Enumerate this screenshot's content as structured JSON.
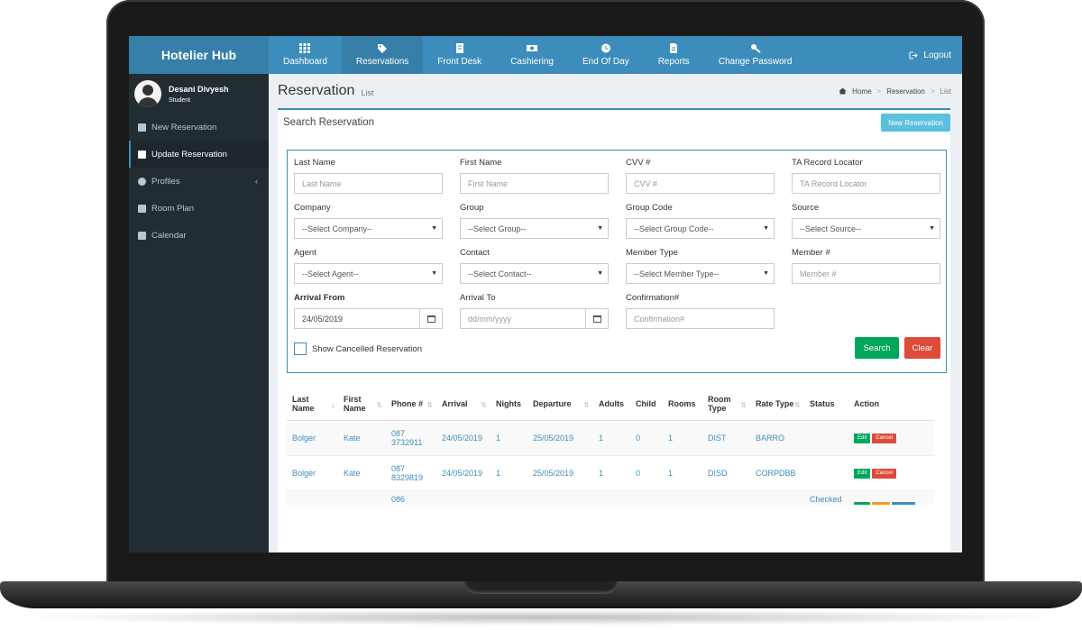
{
  "app": {
    "brand": "Hotelier Hub"
  },
  "nav": {
    "items": [
      {
        "label": "Dashboard",
        "icon": "grid-icon"
      },
      {
        "label": "Reservations",
        "icon": "tag-icon"
      },
      {
        "label": "Front Desk",
        "icon": "book-icon"
      },
      {
        "label": "Cashiering",
        "icon": "money-icon"
      },
      {
        "label": "End Of Day",
        "icon": "clock-icon"
      },
      {
        "label": "Reports",
        "icon": "file-icon"
      },
      {
        "label": "Change Password",
        "icon": "key-icon"
      }
    ],
    "active": "Reservations",
    "logout": "Logout"
  },
  "user": {
    "name": "Desani Divyesh",
    "role": "Student"
  },
  "sidebar": {
    "items": [
      {
        "label": "New Reservation",
        "icon": "tag-icon"
      },
      {
        "label": "Update Reservation",
        "icon": "edit-icon"
      },
      {
        "label": "Profiles",
        "icon": "user-icon"
      },
      {
        "label": "Room Plan",
        "icon": "bed-icon"
      },
      {
        "label": "Calendar",
        "icon": "calendar-icon"
      }
    ]
  },
  "header": {
    "title": "Reservation",
    "subtitle": "List",
    "breadcrumb": [
      "Home",
      "Reservation",
      "List"
    ]
  },
  "search": {
    "title": "Search Reservation",
    "new_button": "New Reservation",
    "fields": {
      "last_name": {
        "label": "Last Name",
        "placeholder": "Last Name"
      },
      "first_name": {
        "label": "First Name",
        "placeholder": "First Name"
      },
      "cvv": {
        "label": "CVV #",
        "placeholder": "CVV #"
      },
      "ta_record": {
        "label": "TA Record Locator",
        "placeholder": "TA Record Locator"
      },
      "company": {
        "label": "Company",
        "value": "--Select Company--"
      },
      "group": {
        "label": "Group",
        "value": "--Select Group--"
      },
      "group_code": {
        "label": "Group Code",
        "value": "--Select Group Code--"
      },
      "source": {
        "label": "Source",
        "value": "--Select Source--"
      },
      "agent": {
        "label": "Agent",
        "value": "--Select Agent--"
      },
      "contact": {
        "label": "Contact",
        "value": "--Select Contact--"
      },
      "member_type": {
        "label": "Member Type",
        "value": "--Select Member Type--"
      },
      "member_no": {
        "label": "Member #",
        "placeholder": "Member #"
      },
      "arrival_from": {
        "label": "Arrival From",
        "value": "24/05/2019"
      },
      "arrival_to": {
        "label": "Arrival To",
        "placeholder": "dd/mm/yyyy"
      },
      "confirmation": {
        "label": "Confirmation#",
        "placeholder": "Confirmation#"
      }
    },
    "show_cancelled": "Show Cancelled Reservation",
    "search_button": "Search",
    "clear_button": "Clear"
  },
  "table": {
    "headers": [
      "Last Name",
      "First Name",
      "Phone #",
      "Arrival",
      "Nights",
      "Departure",
      "Adults",
      "Child",
      "Rooms",
      "Room Type",
      "Rate Type",
      "Status",
      "Action"
    ],
    "edit_label": "Edit",
    "cancel_label": "Cancel",
    "rows": [
      {
        "last": "Bolger",
        "first": "Kate",
        "phone": "087 3732911",
        "arrival": "24/05/2019",
        "nights": "1",
        "departure": "25/05/2019",
        "adults": "1",
        "child": "0",
        "rooms": "1",
        "room_type": "DIST",
        "rate_type": "BARRO",
        "status": ""
      },
      {
        "last": "Bolger",
        "first": "Kate",
        "phone": "087 8329819",
        "arrival": "24/05/2019",
        "nights": "1",
        "departure": "25/05/2019",
        "adults": "1",
        "child": "0",
        "rooms": "1",
        "room_type": "DISD",
        "rate_type": "CORPDBB",
        "status": ""
      },
      {
        "last": "",
        "first": "",
        "phone": "086",
        "arrival": "",
        "nights": "",
        "departure": "",
        "adults": "",
        "child": "",
        "rooms": "",
        "room_type": "",
        "rate_type": "",
        "status": "Checked"
      }
    ]
  }
}
